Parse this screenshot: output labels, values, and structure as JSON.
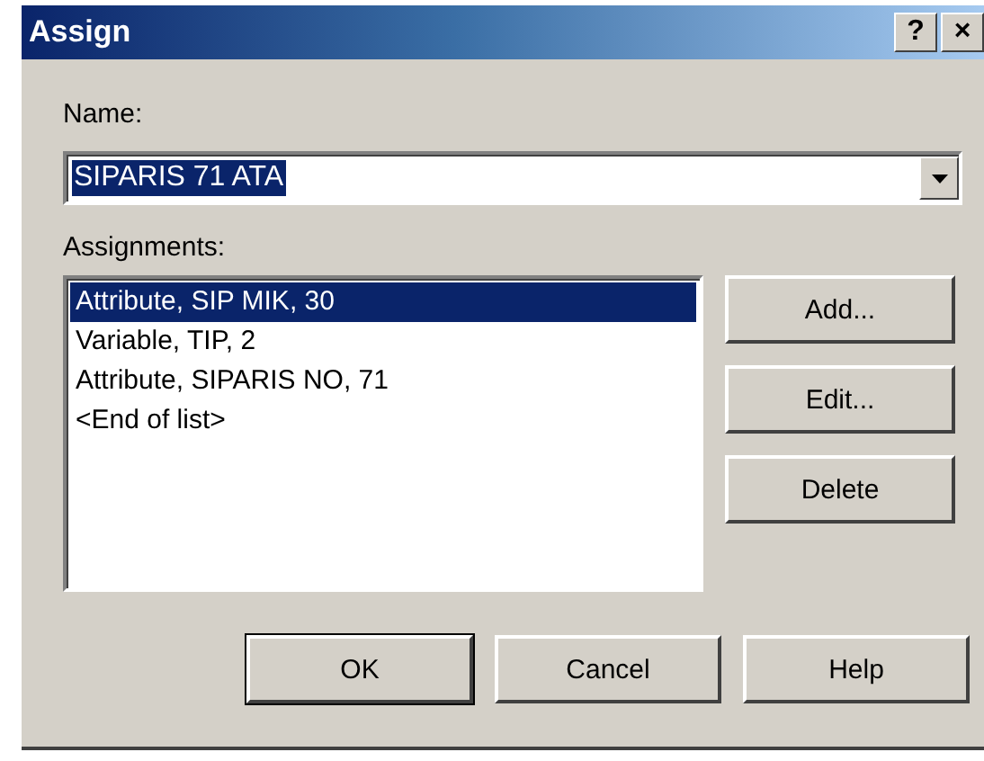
{
  "window": {
    "title": "Assign",
    "title_buttons": [
      "?",
      "×"
    ]
  },
  "name": {
    "label": "Name:",
    "value": "SIPARIS 71 ATA",
    "selected": true
  },
  "assignments": {
    "label": "Assignments:",
    "items": [
      {
        "text": "Attribute, SIP MIK, 30",
        "selected": true
      },
      {
        "text": "Variable, TIP, 2",
        "selected": false
      },
      {
        "text": "Attribute, SIPARIS NO, 71",
        "selected": false
      },
      {
        "text": "<End of list>",
        "selected": false
      }
    ]
  },
  "side_buttons": [
    "Add...",
    "Edit...",
    "Delete"
  ],
  "buttons": [
    {
      "label": "OK",
      "default": true
    },
    {
      "label": "Cancel",
      "default": false
    },
    {
      "label": "Help",
      "default": false
    }
  ]
}
